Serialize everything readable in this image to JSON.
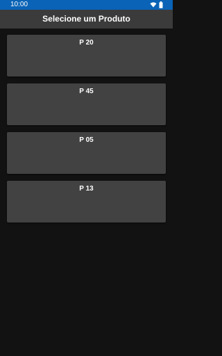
{
  "status_bar": {
    "time": "10:00",
    "icons": [
      "wifi-icon",
      "battery-icon"
    ],
    "color": "#0a63b6"
  },
  "header": {
    "title": "Selecione um Produto",
    "color": "#3b3b3b"
  },
  "products": [
    {
      "label": "P 20"
    },
    {
      "label": "P 45"
    },
    {
      "label": "P 05"
    },
    {
      "label": "P 13"
    }
  ],
  "colors": {
    "background": "#121212",
    "card": "#424242"
  }
}
